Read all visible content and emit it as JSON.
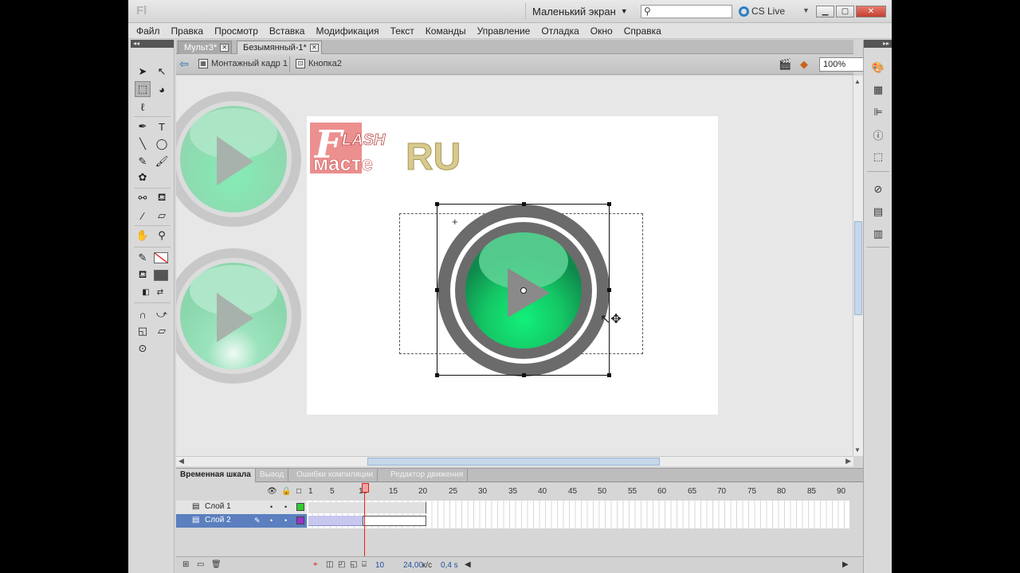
{
  "app": {
    "logo": "Fl",
    "workspace": "Маленький экран",
    "search_placeholder": "",
    "cs_live": "CS Live",
    "window_buttons": {
      "minimize": "▁",
      "maximize": "▢",
      "close": "✕"
    }
  },
  "menu": [
    "Файл",
    "Правка",
    "Просмотр",
    "Вставка",
    "Модификация",
    "Текст",
    "Команды",
    "Управление",
    "Отладка",
    "Окно",
    "Справка"
  ],
  "doc_tabs": [
    {
      "label": "Мульт3*",
      "active": false
    },
    {
      "label": "Безымянный-1*",
      "active": true
    }
  ],
  "editbar": {
    "scene": "Монтажный кадр 1",
    "symbol": "Кнопка2",
    "zoom": "100%"
  },
  "stage": {
    "logo_top": "LASH",
    "logo_bottom": "масте",
    "logo_ru": "RU",
    "logo_f": "F"
  },
  "timeline": {
    "tabs": [
      "Временная шкала",
      "Вывод",
      "Ошибки компиляции",
      "Редактор движения"
    ],
    "frame_numbers": [
      "1",
      "5",
      "10",
      "15",
      "20",
      "25",
      "30",
      "35",
      "40",
      "45",
      "50",
      "55",
      "60",
      "65",
      "70",
      "75",
      "80",
      "85",
      "90"
    ],
    "layers": [
      {
        "name": "Слой 1",
        "selected": false,
        "color": "#33cc33"
      },
      {
        "name": "Слой 2",
        "selected": true,
        "color": "#9933cc"
      }
    ],
    "current_frame": "10",
    "fps": "24,00",
    "fps_unit": "к/с",
    "time": "0,4 s"
  },
  "colors": {
    "accent_blue": "#5b7fbf",
    "button_green": "#1fd07a",
    "button_ring": "#6b6b6b"
  }
}
